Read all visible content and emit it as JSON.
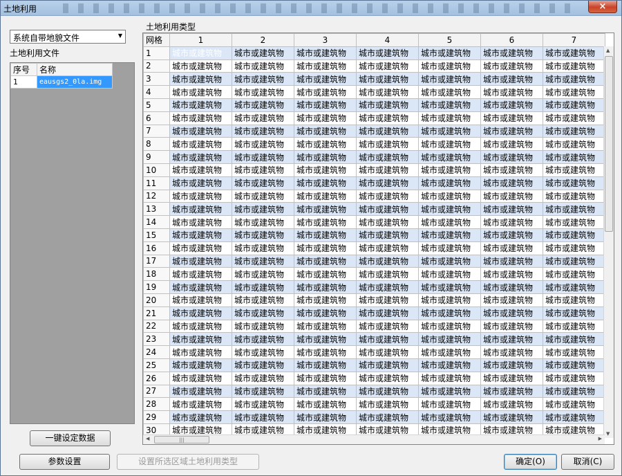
{
  "window": {
    "title": "土地利用"
  },
  "source_combo": {
    "value": "系统自带地貌文件"
  },
  "file_panel": {
    "label": "土地利用文件",
    "headers": {
      "index": "序号",
      "name": "名称"
    },
    "rows": [
      {
        "index": "1",
        "name": "eausgs2_0la.img"
      }
    ]
  },
  "grid_panel": {
    "label": "土地利用类型",
    "corner": "网格",
    "columns": [
      "1",
      "2",
      "3",
      "4",
      "5",
      "6",
      "7"
    ],
    "row_labels": [
      "1",
      "2",
      "3",
      "4",
      "5",
      "6",
      "7",
      "8",
      "9",
      "10",
      "11",
      "12",
      "13",
      "14",
      "15",
      "16",
      "17",
      "18",
      "19",
      "20",
      "21",
      "22",
      "23",
      "24",
      "25",
      "26",
      "27",
      "28",
      "29",
      "30"
    ],
    "cell_value": "城市或建筑物"
  },
  "buttons": {
    "one_key": "一键设定数据",
    "params": "参数设置",
    "set_region": "设置所选区域土地利用类型",
    "ok": "确定(O)",
    "cancel": "取消(C)"
  },
  "icons": {
    "close": "×",
    "dropdown": "▼"
  }
}
